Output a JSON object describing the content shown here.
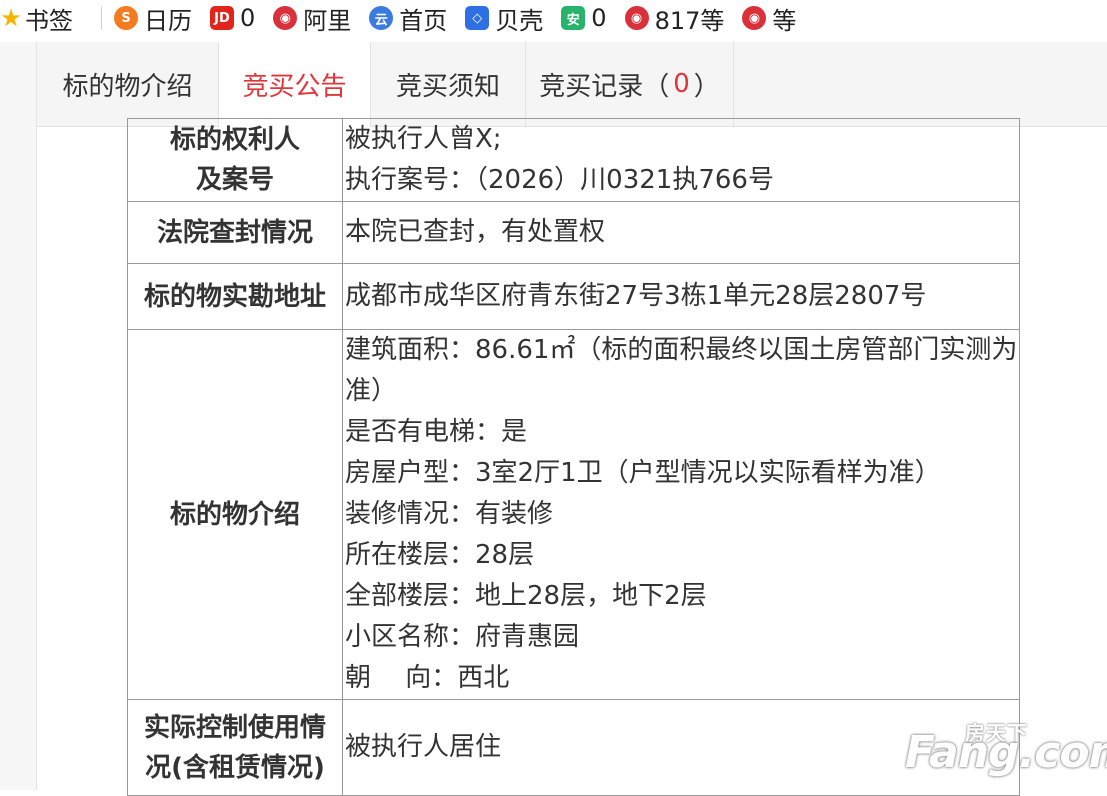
{
  "bookmarks": [
    {
      "icon": "star-icon",
      "glyph": "★",
      "label": "书签",
      "color": "#f4b400"
    },
    {
      "icon": "sina-icon",
      "glyph": "S",
      "label": "日历",
      "color": "#f47b20"
    },
    {
      "icon": "jd-icon",
      "glyph": "JD",
      "label": "0",
      "color": "#e1251b"
    },
    {
      "icon": "ali-icon",
      "glyph": "◉",
      "label": "阿里",
      "color": "#d9303a"
    },
    {
      "icon": "cloud-icon",
      "glyph": "云",
      "label": "首页",
      "color": "#3b7ae0"
    },
    {
      "icon": "beike-icon",
      "glyph": "◇",
      "label": "贝壳",
      "color": "#2f6fe4"
    },
    {
      "icon": "an-icon",
      "glyph": "安",
      "label": "0",
      "color": "#27b36a"
    },
    {
      "icon": "ali-icon",
      "glyph": "◉",
      "label": "817等",
      "color": "#d9303a"
    },
    {
      "icon": "ali-icon",
      "glyph": "◉",
      "label": "等",
      "color": "#d9303a"
    }
  ],
  "tabs": [
    {
      "label": "标的物介绍",
      "active": false
    },
    {
      "label": "竞买公告",
      "active": true
    },
    {
      "label": "竞买须知",
      "active": false
    },
    {
      "label": "竞买记录（",
      "count": "0",
      "suffix": "）",
      "active": false
    }
  ],
  "table": {
    "rows": [
      {
        "key_lines": [
          "标的权利人",
          "及案号"
        ],
        "value_lines": [
          "被执行人曾X;",
          "执行案号：（2026）川0321执766号"
        ]
      },
      {
        "key_lines": [
          "法院查封情况"
        ],
        "value_lines": [
          "本院已查封，有处置权"
        ]
      },
      {
        "key_lines": [
          "标的物实勘地址"
        ],
        "value_lines": [
          "成都市成华区府青东街27号3栋1单元28层2807号"
        ]
      },
      {
        "key_lines": [
          "标的物介绍"
        ],
        "value_lines": [
          "建筑面积：86.61㎡（标的面积最终以国土房管部门实测为准）",
          "是否有电梯：是",
          "房屋户型：3室2厅1卫（户型情况以实际看样为准）",
          "装修情况：有装修",
          "所在楼层：28层",
          "全部楼层：地上28层，地下2层",
          "小区名称：府青惠园",
          "朝　 向：西北"
        ]
      },
      {
        "key_lines": [
          "实际控制使用情",
          "况(含租赁情况)"
        ],
        "value_lines": [
          "被执行人居住"
        ]
      }
    ]
  },
  "watermark": {
    "small": "房天下",
    "big": "Fang.com"
  },
  "colors": {
    "accent": "#e2353a",
    "tab_bg": "#f5f5f5",
    "border": "#999999"
  }
}
